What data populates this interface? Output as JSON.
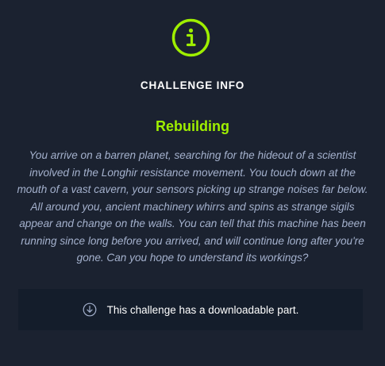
{
  "header": {
    "title": "CHALLENGE INFO",
    "icon": "info-circle-icon",
    "accent_color": "#9fef00"
  },
  "challenge": {
    "name": "Rebuilding",
    "description": "You arrive on a barren planet, searching for the hideout of a scientist involved in the Longhir resistance movement. You touch down at the mouth of a vast cavern, your sensors picking up strange noises far below. All around you, ancient machinery whirrs and spins as strange sigils appear and change on the walls. You can tell that this machine has been running since long before you arrived, and will continue long after you're gone. Can you hope to understand its workings?"
  },
  "download": {
    "icon": "download-icon",
    "text": "This challenge has a downloadable part."
  }
}
